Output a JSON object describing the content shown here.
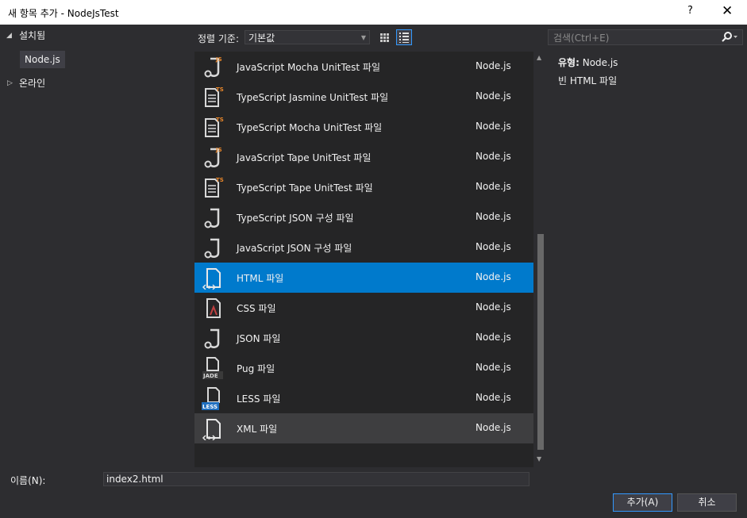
{
  "window": {
    "title": "새 항목 추가 - NodeJsTest",
    "help": "?",
    "close": "✕"
  },
  "tree": {
    "installed_label": "설치됨",
    "installed_child": "Node.js",
    "online_label": "온라인"
  },
  "toolbar": {
    "sort_label": "정렬 기준:",
    "sort_value": "기본값"
  },
  "search": {
    "placeholder": "검색(Ctrl+E)"
  },
  "templates": [
    {
      "name": "JavaScript Mocha UnitTest 파일",
      "type": "Node.js",
      "icon": "js-unittest-icon",
      "badge": "JS"
    },
    {
      "name": "TypeScript Jasmine UnitTest 파일",
      "type": "Node.js",
      "icon": "ts-file-icon",
      "badge": "TS"
    },
    {
      "name": "TypeScript Mocha UnitTest 파일",
      "type": "Node.js",
      "icon": "ts-file-icon",
      "badge": "TS"
    },
    {
      "name": "JavaScript Tape UnitTest 파일",
      "type": "Node.js",
      "icon": "js-unittest-icon",
      "badge": "JS"
    },
    {
      "name": "TypeScript Tape UnitTest 파일",
      "type": "Node.js",
      "icon": "ts-file-icon",
      "badge": "TS"
    },
    {
      "name": "TypeScript JSON 구성 파일",
      "type": "Node.js",
      "icon": "json-icon",
      "badge": ""
    },
    {
      "name": "JavaScript JSON 구성 파일",
      "type": "Node.js",
      "icon": "json-icon",
      "badge": ""
    },
    {
      "name": "HTML 파일",
      "type": "Node.js",
      "icon": "html-file-icon",
      "badge": ""
    },
    {
      "name": "CSS 파일",
      "type": "Node.js",
      "icon": "css-file-icon",
      "badge": ""
    },
    {
      "name": "JSON 파일",
      "type": "Node.js",
      "icon": "json-icon",
      "badge": ""
    },
    {
      "name": "Pug 파일",
      "type": "Node.js",
      "icon": "pug-file-icon",
      "badge": "JADE"
    },
    {
      "name": "LESS 파일",
      "type": "Node.js",
      "icon": "less-file-icon",
      "badge": "LESS"
    },
    {
      "name": "XML 파일",
      "type": "Node.js",
      "icon": "xml-file-icon",
      "badge": ""
    }
  ],
  "selected_index": 7,
  "hover_index": 12,
  "details": {
    "type_label": "유형:",
    "type_value": "Node.js",
    "description": "빈 HTML 파일"
  },
  "name_field": {
    "label": "이름(N):",
    "value": "index2.html"
  },
  "buttons": {
    "add": "추가(A)",
    "cancel": "취소"
  },
  "colors": {
    "accent": "#007acc",
    "background": "#2d2d30",
    "list_bg": "#252526",
    "js_badge": "#e8862a",
    "less_badge": "#1f6fbf"
  }
}
